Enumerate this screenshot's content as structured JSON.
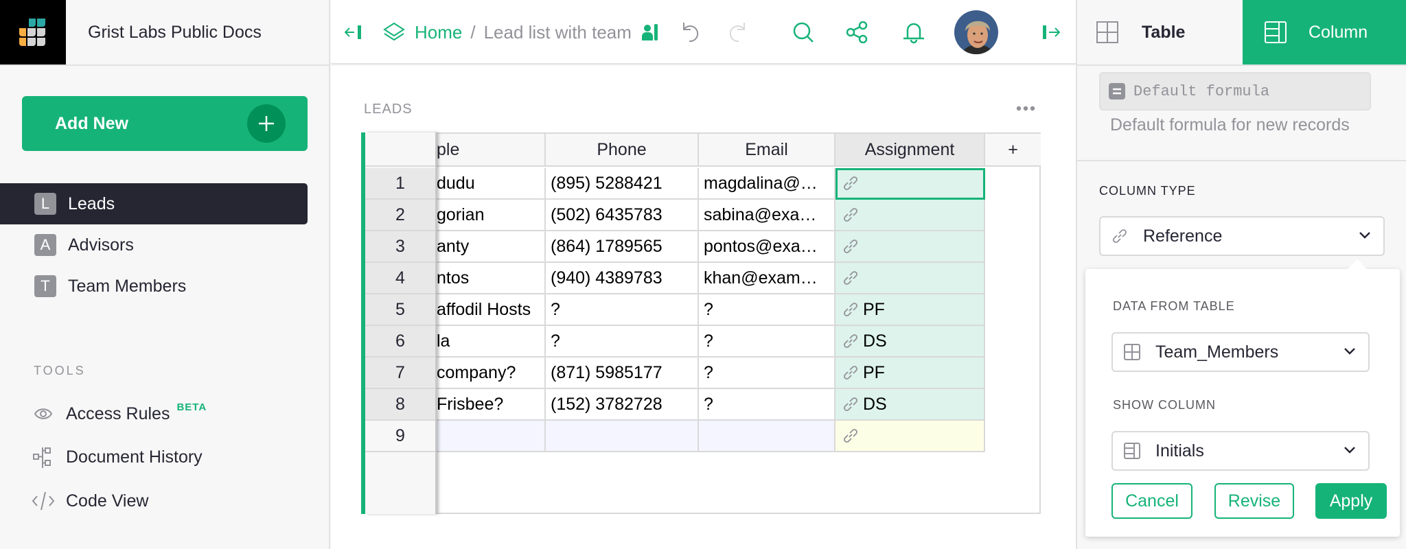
{
  "left_panel": {
    "org_name": "Grist Labs Public Docs",
    "add_new_label": "Add New",
    "pages": [
      {
        "badge": "L",
        "label": "Leads",
        "active": true
      },
      {
        "badge": "A",
        "label": "Advisors",
        "active": false
      },
      {
        "badge": "T",
        "label": "Team Members",
        "active": false
      }
    ],
    "tools_label": "TOOLS",
    "tools": [
      {
        "icon": "eye-icon",
        "label": "Access Rules",
        "badge": "BETA"
      },
      {
        "icon": "document-history-icon",
        "label": "Document History"
      },
      {
        "icon": "code-icon",
        "label": "Code View"
      }
    ]
  },
  "topbar": {
    "breadcrumb_home": "Home",
    "breadcrumb_separator": "/",
    "document_name": "Lead list with team",
    "icons": [
      "collapse-left-icon",
      "home-layers-icon",
      "sharing-icon",
      "undo-icon",
      "redo-icon",
      "search-icon",
      "share-icon",
      "notifications-bell-icon",
      "user-avatar",
      "expand-right-icon"
    ]
  },
  "section": {
    "title": "LEADS",
    "columns": [
      "ple",
      "Phone",
      "Email",
      "Assignment"
    ],
    "add_column_label": "+",
    "rows": [
      {
        "num": "1",
        "name": "dudu",
        "phone": "(895) 5288421",
        "email": "magdalina@…",
        "assignment": ""
      },
      {
        "num": "2",
        "name": "gorian",
        "phone": "(502) 6435783",
        "email": "sabina@exa…",
        "assignment": ""
      },
      {
        "num": "3",
        "name": "anty",
        "phone": "(864) 1789565",
        "email": "pontos@exa…",
        "assignment": ""
      },
      {
        "num": "4",
        "name": "ntos",
        "phone": "(940) 4389783",
        "email": "khan@exam…",
        "assignment": ""
      },
      {
        "num": "5",
        "name": "affodil Hosts",
        "phone": "?",
        "email": "?",
        "assignment": "PF"
      },
      {
        "num": "6",
        "name": "la",
        "phone": "?",
        "email": "?",
        "assignment": "DS"
      },
      {
        "num": "7",
        "name": "company?",
        "phone": "(871) 5985177",
        "email": "?",
        "assignment": "PF"
      },
      {
        "num": "8",
        "name": " Frisbee?",
        "phone": "(152) 3782728",
        "email": "?",
        "assignment": "DS"
      },
      {
        "num": "9",
        "name": "",
        "phone": "",
        "email": "",
        "assignment": ""
      }
    ]
  },
  "right_panel": {
    "tab_table": "Table",
    "tab_column": "Column",
    "default_formula_placeholder": "Default formula",
    "default_formula_hint": "Default formula for new records",
    "column_type_label": "COLUMN TYPE",
    "column_type_value": "Reference",
    "popup": {
      "data_from_table_label": "DATA FROM TABLE",
      "data_from_table_value": "Team_Members",
      "show_column_label": "SHOW COLUMN",
      "show_column_value": "Initials",
      "cancel_label": "Cancel",
      "revise_label": "Revise",
      "apply_label": "Apply"
    }
  },
  "colors": {
    "accent": "#16b378",
    "dark": "#262633",
    "ref_cell_bg": "#ddf3ec",
    "new_row_bg": "#f4f5fe"
  }
}
